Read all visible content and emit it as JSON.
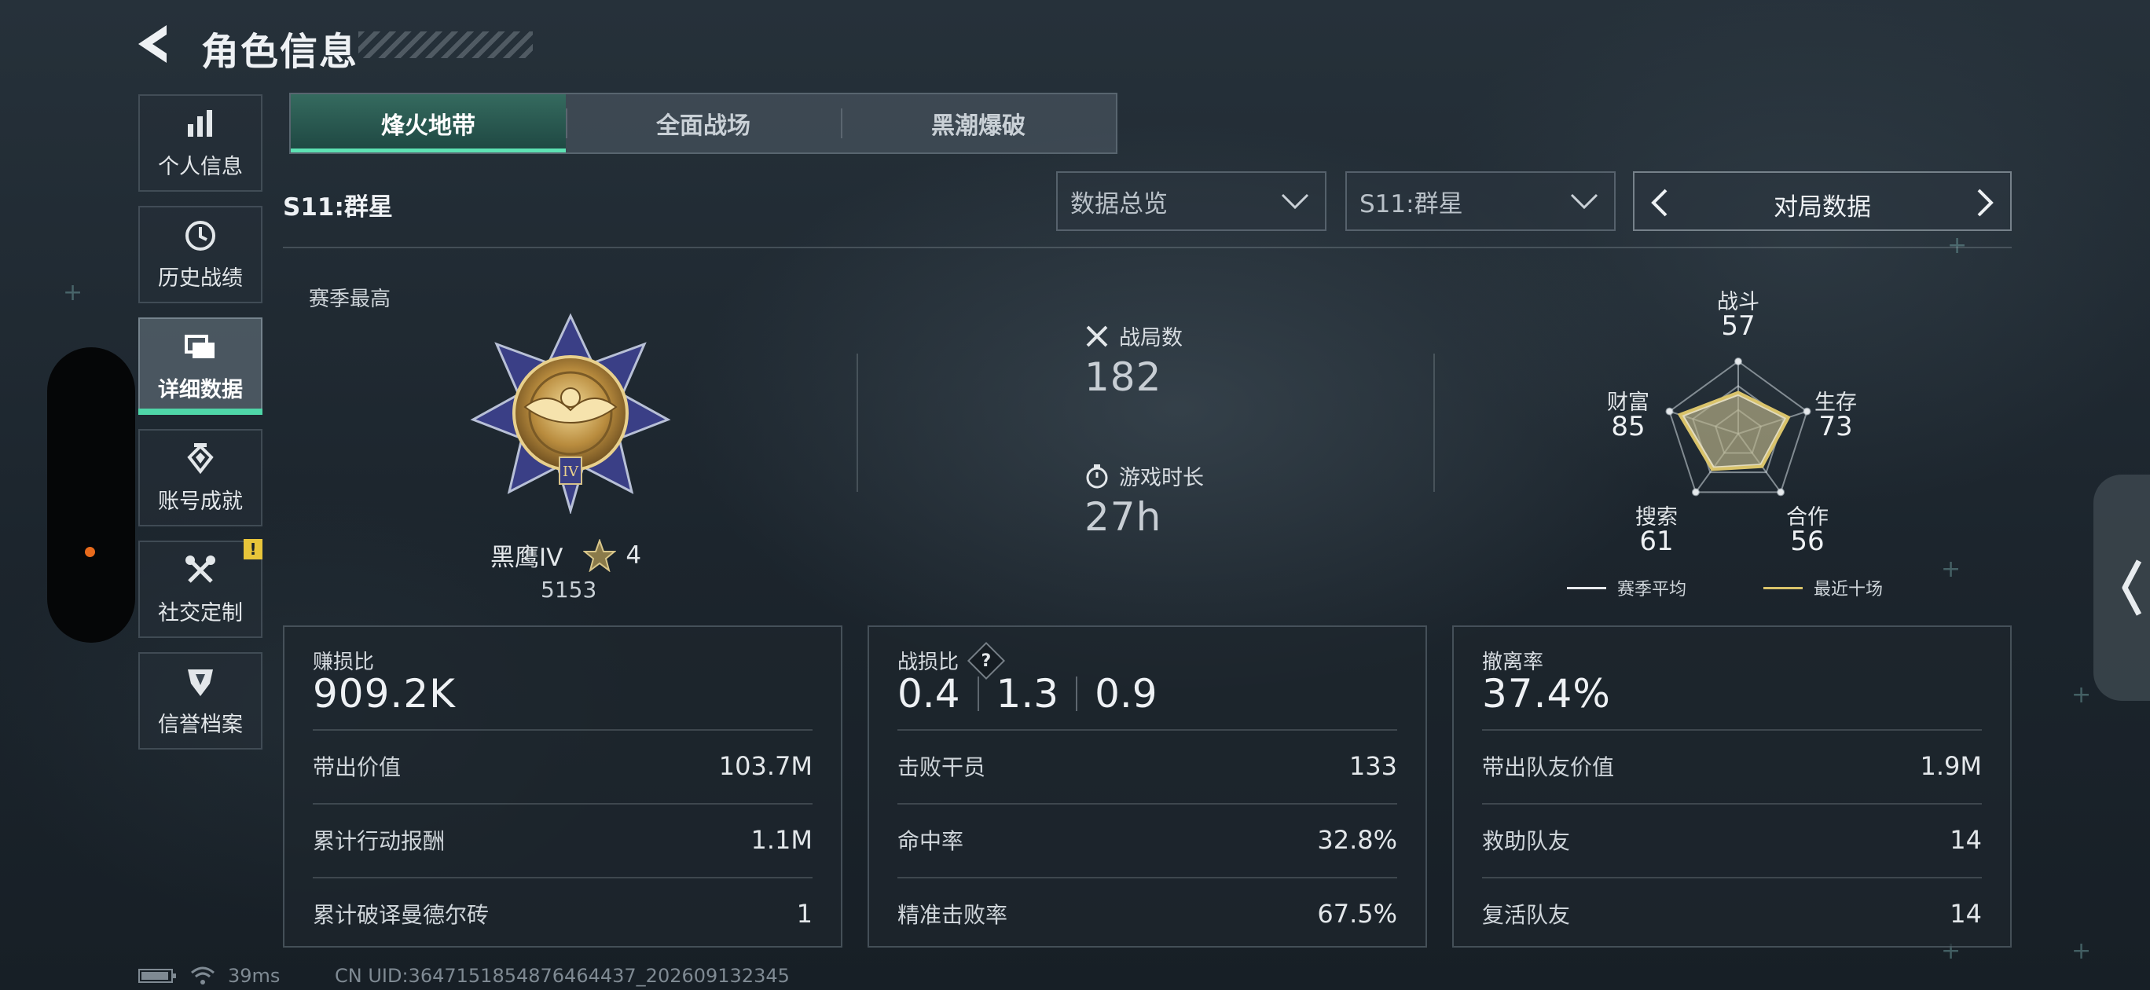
{
  "header": {
    "title": "角色信息"
  },
  "sidebar": {
    "items": [
      {
        "label": "个人信息",
        "icon": "bar-chart-icon"
      },
      {
        "label": "历史战绩",
        "icon": "clock-icon"
      },
      {
        "label": "详细数据",
        "icon": "stack-icon",
        "active": true
      },
      {
        "label": "账号成就",
        "icon": "medal-icon"
      },
      {
        "label": "社交定制",
        "icon": "tools-icon",
        "badge": "!"
      },
      {
        "label": "信誉档案",
        "icon": "shield-icon"
      }
    ]
  },
  "mode_tabs": [
    {
      "label": "烽火地带",
      "active": true
    },
    {
      "label": "全面战场"
    },
    {
      "label": "黑潮爆破"
    }
  ],
  "filters": {
    "season_label": "S11:群星",
    "overview_dropdown": "数据总览",
    "season_dropdown": "S11:群星",
    "nav_selector": "对局数据"
  },
  "summary": {
    "season_high_label": "赛季最高",
    "rank_name": "黑鹰IV",
    "rank_stars": "4",
    "rank_points": "5153",
    "matches_label": "战局数",
    "matches_value": "182",
    "playtime_label": "游戏时长",
    "playtime_value": "27h"
  },
  "radar": {
    "axes": [
      {
        "label": "战斗",
        "value": "57"
      },
      {
        "label": "生存",
        "value": "73"
      },
      {
        "label": "合作",
        "value": "56"
      },
      {
        "label": "搜索",
        "value": "61"
      },
      {
        "label": "财富",
        "value": "85"
      }
    ],
    "legend_season_avg": "赛季平均",
    "legend_recent": "最近十场",
    "colors": {
      "season_avg": "#e6e9ec",
      "recent": "#d9c36a"
    }
  },
  "cards": {
    "profit": {
      "title": "赚损比",
      "main": "909.2K",
      "rows": [
        {
          "label": "带出价值",
          "value": "103.7M"
        },
        {
          "label": "累计行动报酬",
          "value": "1.1M"
        },
        {
          "label": "累计破译曼德尔砖",
          "value": "1"
        }
      ]
    },
    "combat": {
      "title": "战损比",
      "help": "?",
      "ratios": [
        "0.4",
        "1.3",
        "0.9"
      ],
      "rows": [
        {
          "label": "击败干员",
          "value": "133"
        },
        {
          "label": "命中率",
          "value": "32.8%"
        },
        {
          "label": "精准击败率",
          "value": "67.5%"
        }
      ]
    },
    "extract": {
      "title": "撤离率",
      "main": "37.4%",
      "rows": [
        {
          "label": "带出队友价值",
          "value": "1.9M"
        },
        {
          "label": "救助队友",
          "value": "14"
        },
        {
          "label": "复活队友",
          "value": "14"
        }
      ]
    }
  },
  "footer": {
    "ping": "39ms",
    "uid": "CN UID:3647151854876464437_202609132345"
  },
  "accent_color": "#5ee2b4"
}
